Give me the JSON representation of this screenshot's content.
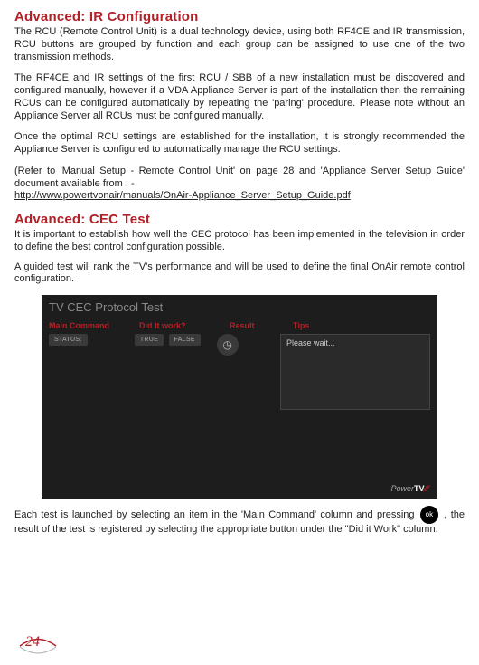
{
  "sections": {
    "ir": {
      "heading": "Advanced: IR Configuration",
      "p1": "The RCU (Remote Control Unit) is a dual technology device, using both RF4CE and IR transmission, RCU buttons are grouped by function and each group can be assigned to use one of the two transmission methods.",
      "p2": "The RF4CE and IR settings of the first RCU / SBB of a new installation must be discovered and configured manually, however if a VDA Appliance Server is part of the installation then the remaining RCUs can be configured automatically by repeating the 'paring' procedure. Please note without an Appliance Server all RCUs must be configured manually.",
      "p3": "Once the optimal RCU settings are established for the installation, it is strongly recommended the Appliance Server is configured to automatically manage the RCU settings.",
      "p4a": "(Refer to 'Manual Setup -  Remote Control Unit' on page 28 and 'Appliance Server Setup Guide' document available from : -",
      "link": "http://www.powertvonair/manuals/OnAir-Appliance_Server_Setup_Guide.pdf"
    },
    "cec": {
      "heading": "Advanced: CEC Test",
      "p1": "It is important to establish how well the CEC protocol has been implemented in the television in order to define the best control configuration possible.",
      "p2": "A guided test will rank the TV's performance and will be used to define the final OnAir remote control configuration."
    }
  },
  "panel": {
    "title": "TV CEC Protocol Test",
    "headers": {
      "main": "Main Command",
      "did": "Did It work?",
      "result": "Result",
      "tips": "Tips"
    },
    "row": {
      "status": "STATUS:",
      "true": "TRUE",
      "false": "FALSE",
      "tipsText": "Please wait..."
    },
    "brand": {
      "power": "Power",
      "tv": "TV"
    }
  },
  "launch": {
    "part1": "Each test is launched by selecting an item in the 'Main Command' column and pressing ",
    "ok": "ok",
    "part2": ", the result of the test is registered by selecting the appropriate button under the \"Did it Work\" column."
  },
  "page": "24"
}
